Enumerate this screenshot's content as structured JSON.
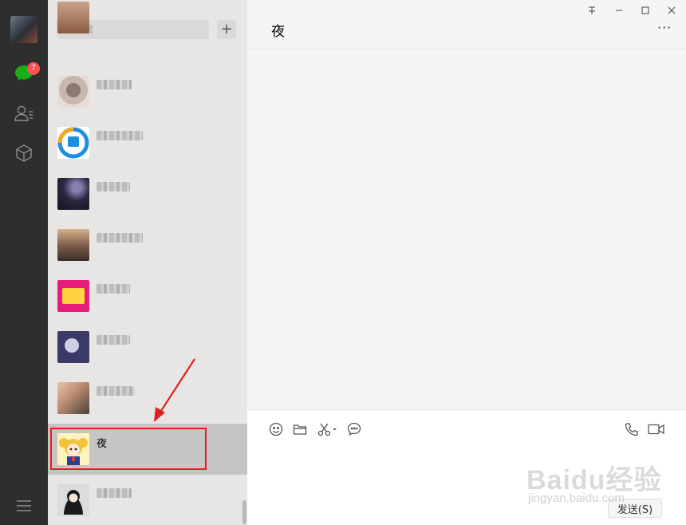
{
  "nav": {
    "badge_count": "7",
    "icons": [
      "chat-icon",
      "contacts-icon",
      "favorites-icon",
      "menu-icon"
    ]
  },
  "chatlist": {
    "search": {
      "placeholder": "搜索"
    },
    "add_label": "+",
    "items": [
      {
        "name": "",
        "blurred": true
      },
      {
        "name": "",
        "blurred": true
      },
      {
        "name": "",
        "blurred": true
      },
      {
        "name": "",
        "blurred": true
      },
      {
        "name": "",
        "blurred": true
      },
      {
        "name": "",
        "blurred": true
      },
      {
        "name": "",
        "blurred": true
      },
      {
        "name": "夜",
        "blurred": false,
        "active": true
      },
      {
        "name": "",
        "blurred": true
      }
    ]
  },
  "main": {
    "title": "夜",
    "more_label": "···",
    "send_label": "发送(S)",
    "window_buttons": [
      "pin-icon",
      "minimize-icon",
      "maximize-icon",
      "close-icon"
    ]
  },
  "watermark": {
    "logo": "Baidu经验",
    "sub": "jingyan.baidu.com"
  },
  "colors": {
    "nav_bg": "#2e2e2e",
    "list_bg": "#e7e6e5",
    "active_bg": "#c6c5c4",
    "badge": "#fa5151",
    "highlight": "#e02020"
  }
}
